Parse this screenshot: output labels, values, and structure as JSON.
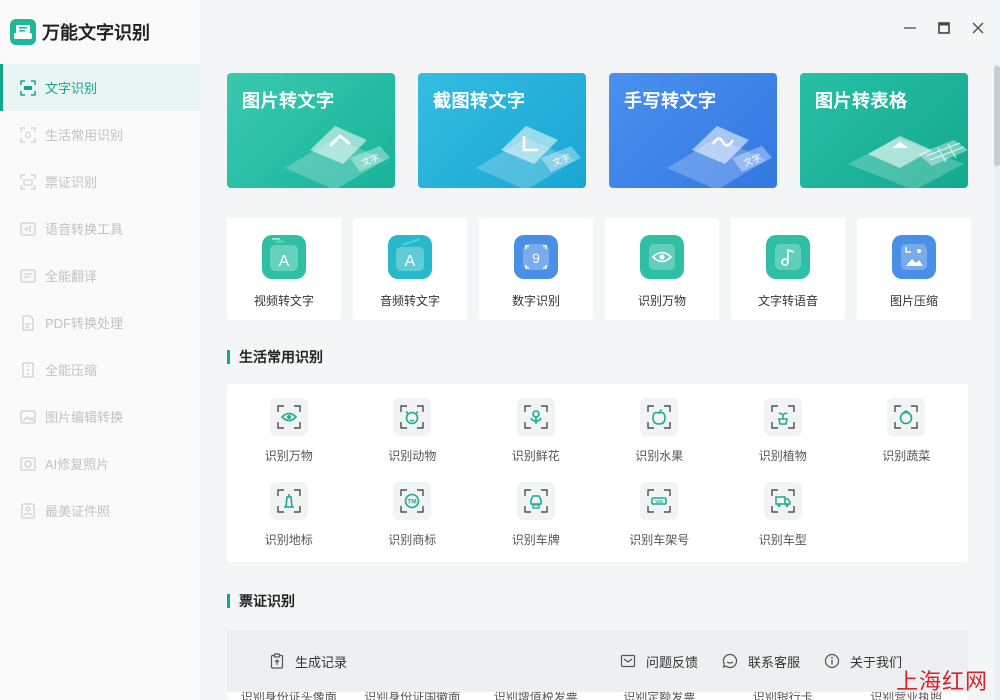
{
  "app": {
    "title": "万能文字识别"
  },
  "sidebar": {
    "items": [
      {
        "label": "文字识别",
        "active": true
      },
      {
        "label": "生活常用识别"
      },
      {
        "label": "票证识别"
      },
      {
        "label": "语音转换工具"
      },
      {
        "label": "全能翻译"
      },
      {
        "label": "PDF转换处理"
      },
      {
        "label": "全能压缩"
      },
      {
        "label": "图片编辑转换"
      },
      {
        "label": "AI修复照片"
      },
      {
        "label": "最美证件照"
      }
    ]
  },
  "banners": [
    {
      "title": "图片转文字",
      "doc_text": "文字"
    },
    {
      "title": "截图转文字",
      "doc_text": "文字"
    },
    {
      "title": "手写转文字",
      "doc_text": "文字"
    },
    {
      "title": "图片转表格"
    }
  ],
  "tools": [
    {
      "label": "视频转文字",
      "icon": "video-text-icon",
      "glyph": "A"
    },
    {
      "label": "音频转文字",
      "icon": "audio-text-icon",
      "glyph": "A"
    },
    {
      "label": "数字识别",
      "icon": "number-icon",
      "glyph": "9"
    },
    {
      "label": "识别万物",
      "icon": "eye-icon"
    },
    {
      "label": "文字转语音",
      "icon": "music-note-icon",
      "glyph": "♪"
    },
    {
      "label": "图片压缩",
      "icon": "image-compress-icon"
    }
  ],
  "life_section": {
    "title": "生活常用识别"
  },
  "life_items": [
    {
      "label": "识别万物",
      "icon": "eye-icon"
    },
    {
      "label": "识别动物",
      "icon": "animal-icon"
    },
    {
      "label": "识别鲜花",
      "icon": "flower-icon"
    },
    {
      "label": "识别水果",
      "icon": "fruit-icon"
    },
    {
      "label": "识别植物",
      "icon": "plant-icon"
    },
    {
      "label": "识别蔬菜",
      "icon": "vegetable-icon"
    },
    {
      "label": "识别地标",
      "icon": "landmark-icon"
    },
    {
      "label": "识别商标",
      "icon": "trademark-icon",
      "glyph": "TM"
    },
    {
      "label": "识别车牌",
      "icon": "car-plate-icon"
    },
    {
      "label": "识别车架号",
      "icon": "vin-icon",
      "glyph": "VIN"
    },
    {
      "label": "识别车型",
      "icon": "truck-icon"
    }
  ],
  "cert_section": {
    "title": "票证识别"
  },
  "cert_items": [
    {
      "label": "识别身份证头像面"
    },
    {
      "label": "识别身份证国徽面"
    },
    {
      "label": "识别增值税发票"
    },
    {
      "label": "识别定额发票"
    },
    {
      "label": "识别银行卡"
    },
    {
      "label": "识别营业执照"
    }
  ],
  "bottom_bar": {
    "history": "生成记录",
    "feedback": "问题反馈",
    "support": "联系客服",
    "about": "关于我们"
  },
  "watermark": "上海红网",
  "colors": {
    "accent": "#15a58b"
  }
}
